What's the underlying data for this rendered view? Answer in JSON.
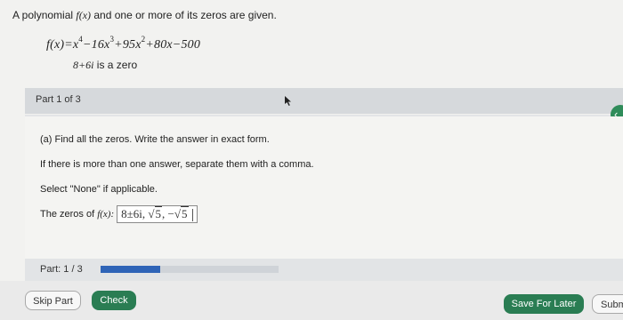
{
  "problem": {
    "intro_pre": "A polynomial ",
    "fx": "f(x)",
    "intro_post": " and one or more of its zeros are given.",
    "eq": {
      "lhs": "f(x)=x",
      "e1": "4",
      "t2": "−16x",
      "e2": "3",
      "t3": "+95x",
      "e3": "2",
      "t4": "+80x−500"
    },
    "zero_value": "8+6i",
    "zero_suffix": " is a zero"
  },
  "part": {
    "header_label": "Part 1 of 3"
  },
  "question": {
    "line_a": "(a) Find all the zeros. Write the answer in exact form.",
    "line_multi": "If there is more than one answer, separate them with a comma.",
    "line_none": "Select \"None\" if applicable.",
    "answer_prefix": "The zeros of ",
    "answer_fx": "f(x):",
    "answer": {
      "a": "8±6i,",
      "rad1": "√",
      "r1": "5",
      "sep": ",",
      "neg": "−",
      "rad2": "√",
      "r2": "5"
    }
  },
  "progress": {
    "label": "Part: 1 / 3",
    "fraction": 0.3333
  },
  "buttons": {
    "skip": "Skip Part",
    "check": "Check",
    "save": "Save For Later",
    "submit": "Subm"
  },
  "colors": {
    "accent_green": "#2a7d53",
    "progress_blue": "#2f64b7"
  }
}
